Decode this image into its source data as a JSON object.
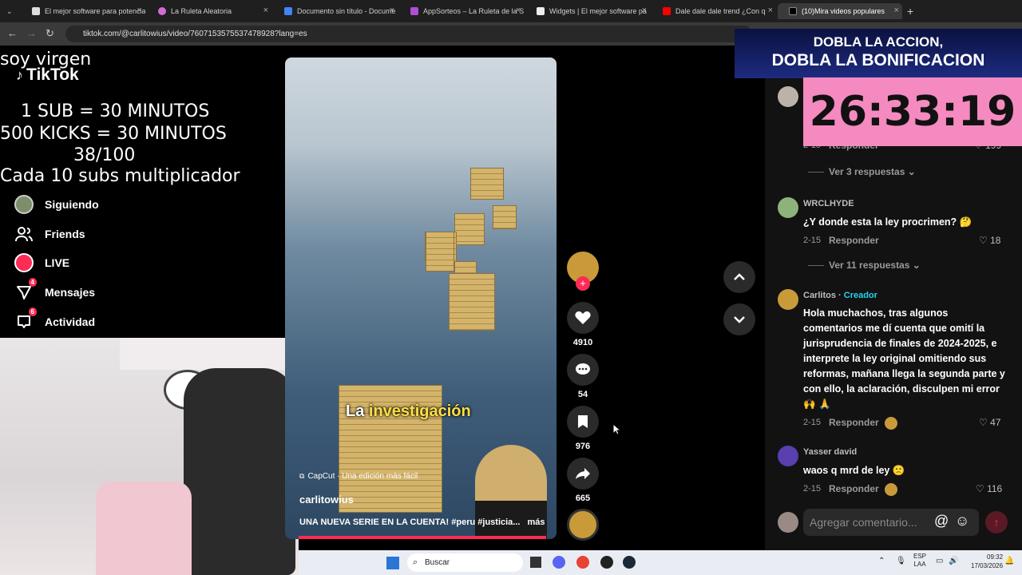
{
  "tabs": [
    {
      "label": "El mejor software para potencia"
    },
    {
      "label": "La Ruleta Aleatoria"
    },
    {
      "label": "Documento sin título - Docume"
    },
    {
      "label": "AppSorteos – La Ruleta de la S"
    },
    {
      "label": "Widgets | El mejor software pa"
    },
    {
      "label": "Dale dale dale trend ¿Con q"
    },
    {
      "label": "(10)Mira videos populares"
    }
  ],
  "address": {
    "url": "tiktok.com/@carlitowius/video/7607153575537478928?lang=es"
  },
  "overlay": {
    "line1": "soy virgen",
    "line2": "1 SUB      = 30 MINUTOS",
    "line3": "500 KICKS = 30 MINUTOS",
    "line4": "38/100",
    "line5": "Cada 10 subs multiplicador"
  },
  "brand": {
    "logo_text": "TikTok"
  },
  "sidebar": {
    "items": [
      {
        "label": "Siguiendo",
        "icon": "avatar-icon"
      },
      {
        "label": "Friends",
        "icon": "people-icon"
      },
      {
        "label": "LIVE",
        "icon": "live-icon"
      },
      {
        "label": "Mensajes",
        "icon": "send-icon",
        "badge": "4"
      },
      {
        "label": "Actividad",
        "icon": "inbox-icon",
        "badge": "6"
      }
    ]
  },
  "video": {
    "caption_word1": "La",
    "caption_word2": "investigación",
    "capcut": "CapCut · Una edición más fácil",
    "author": "carlitowius",
    "description": "UNA NUEVA SERIE EN LA CUENTA! #peru #justicia...",
    "more": "más",
    "progress": 0.98
  },
  "actions": {
    "likes": "4910",
    "comments": "54",
    "saves": "976",
    "shares": "665"
  },
  "comments": {
    "c0": {
      "meta": "2-15",
      "reply": "Responder",
      "likes": "199"
    },
    "c0_more": "Ver 3 respuestas",
    "c1": {
      "name": "WRCLHYDE",
      "text": "¿Y donde esta la ley procrimen? 🤔",
      "meta": "2-15",
      "reply": "Responder",
      "likes": "18"
    },
    "c1_more": "Ver 11 respuestas",
    "c2": {
      "name": "Carlitos",
      "creator": "Creador",
      "text": "Hola muchachos, tras algunos comentarios me dí cuenta que omití la jurisprudencia de finales de 2024-2025, e interprete la ley original omitiendo sus reformas, mañana llega la segunda parte y con ello, la aclaración, disculpen mi error 🙌 🙏",
      "meta": "2-15",
      "reply": "Responder",
      "likes": "47"
    },
    "c3": {
      "name": "Yasser david",
      "text": "waos q mrd de ley 🙁",
      "meta": "2-15",
      "reply": "Responder",
      "likes": "116"
    },
    "input_placeholder": "Agregar comentario..."
  },
  "promo": {
    "line1": "DOBLA LA ACCION,",
    "line2": "DOBLA LA BONIFICACION",
    "timer": "26:33:19"
  },
  "taskbar": {
    "search": "Buscar",
    "lang1": "ESP",
    "lang2": "LAA",
    "time": "09:32",
    "date": "17/03/2026"
  },
  "colors": {
    "accent": "#fe2c55",
    "creator": "#20d5ec"
  }
}
